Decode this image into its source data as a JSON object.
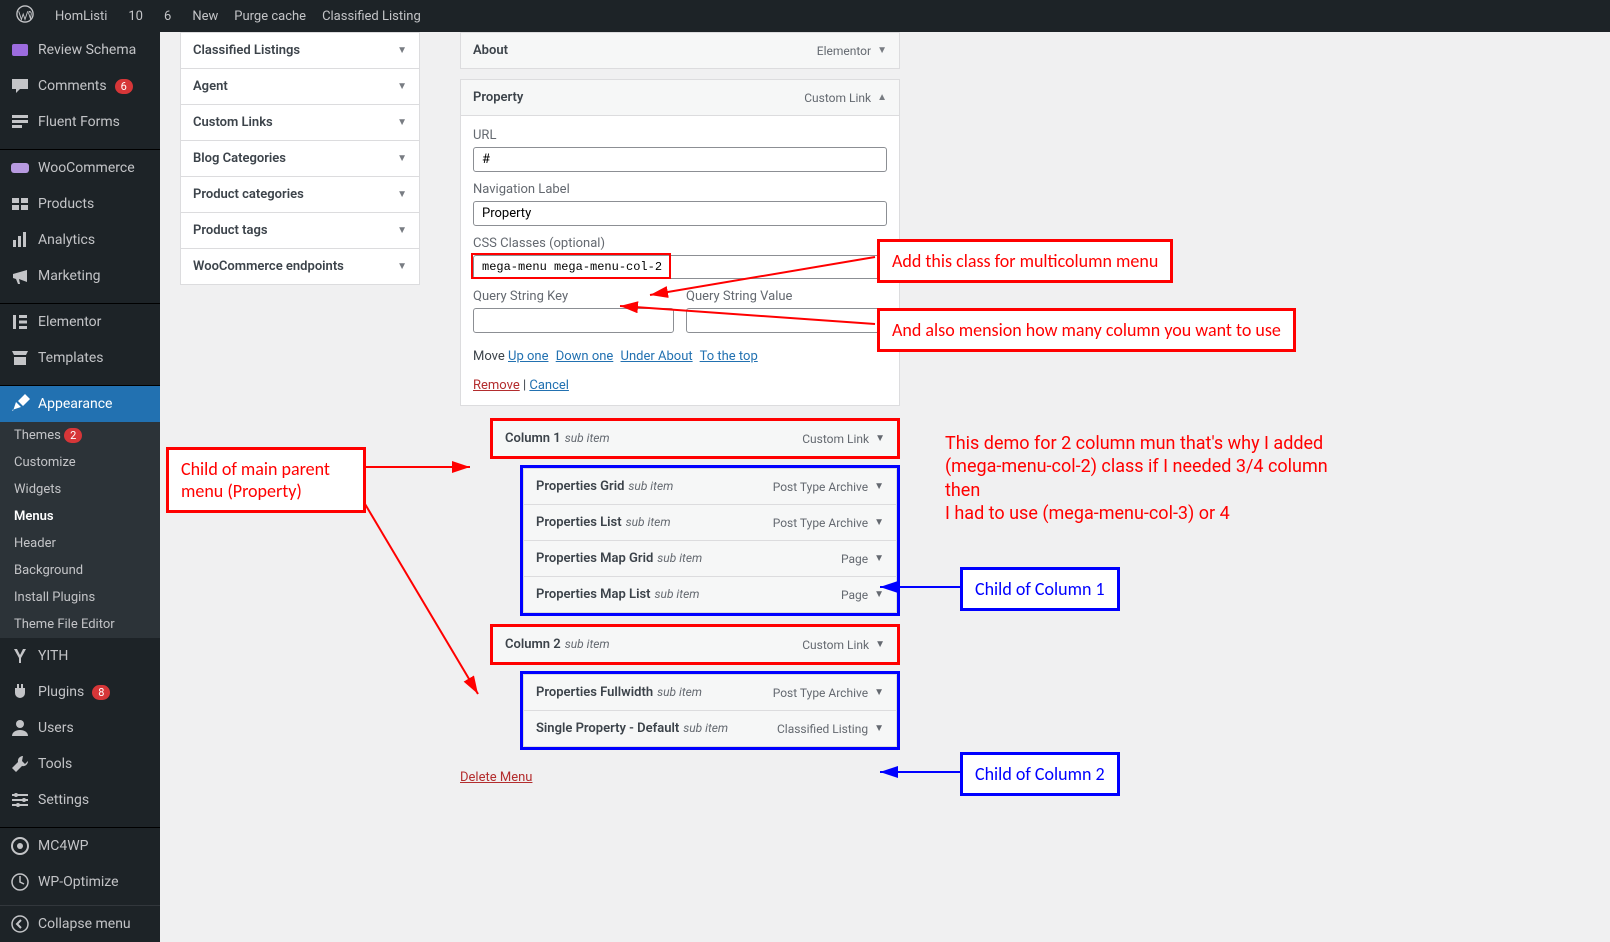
{
  "adminbar": {
    "site": "HomListi",
    "updates": "10",
    "comments": "6",
    "new": "New",
    "purge": "Purge cache",
    "classified": "Classified Listing"
  },
  "sidebar": {
    "review_schema": "Review Schema",
    "comments": "Comments",
    "comments_badge": "6",
    "fluent_forms": "Fluent Forms",
    "woocommerce": "WooCommerce",
    "products": "Products",
    "analytics": "Analytics",
    "marketing": "Marketing",
    "elementor": "Elementor",
    "templates": "Templates",
    "appearance": "Appearance",
    "themes": "Themes",
    "themes_badge": "2",
    "customize": "Customize",
    "widgets": "Widgets",
    "menus": "Menus",
    "header": "Header",
    "background": "Background",
    "install_plugins": "Install Plugins",
    "theme_editor": "Theme File Editor",
    "yith": "YITH",
    "plugins": "Plugins",
    "plugins_badge": "8",
    "users": "Users",
    "tools": "Tools",
    "settings": "Settings",
    "mc4wp": "MC4WP",
    "wp_optimize": "WP-Optimize",
    "collapse": "Collapse menu"
  },
  "panels": {
    "classified_listings": "Classified Listings",
    "agent": "Agent",
    "custom_links": "Custom Links",
    "blog_categories": "Blog Categories",
    "product_categories": "Product categories",
    "product_tags": "Product tags",
    "wc_endpoints": "WooCommerce endpoints"
  },
  "editor": {
    "about_title": "About",
    "about_meta": "Elementor",
    "property_title": "Property",
    "property_meta": "Custom Link",
    "url_label": "URL",
    "url_value": "#",
    "nav_label": "Navigation Label",
    "nav_value": "Property",
    "css_label": "CSS Classes (optional)",
    "css_value": "mega-menu mega-menu-col-2",
    "qsk_label": "Query String Key",
    "qsv_label": "Query String Value",
    "move": "Move",
    "up_one": "Up one",
    "down_one": "Down one",
    "under_about": "Under About",
    "to_top": "To the top",
    "remove": "Remove",
    "cancel": "Cancel",
    "sub_item": "sub item",
    "col1": "Column 1",
    "col1_meta": "Custom Link",
    "col2": "Column 2",
    "col2_meta": "Custom Link",
    "pgrid": "Properties Grid",
    "pgrid_meta": "Post Type Archive",
    "plist": "Properties List",
    "plist_meta": "Post Type Archive",
    "pmgrid": "Properties Map Grid",
    "pmgrid_meta": "Page",
    "pmlist": "Properties Map List",
    "pmlist_meta": "Page",
    "pfull": "Properties Fullwidth",
    "pfull_meta": "Post Type Archive",
    "psingle": "Single Property - Default",
    "psingle_meta": "Classified Listing",
    "delete_menu": "Delete Menu"
  },
  "annotations": {
    "child_parent": "Child of main parent menu (Property)",
    "add_class": "Add this class for multicolumn menu",
    "mention_col": "And also mension how many column you want to use",
    "demo_text_1": "This demo for 2 column mun that's why I added",
    "demo_text_2": "(mega-menu-col-2) class if I needed 3/4 column then",
    "demo_text_3": "I had to use (mega-menu-col-3) or 4",
    "child_col1": "Child of Column 1",
    "child_col2": "Child of Column 2"
  }
}
